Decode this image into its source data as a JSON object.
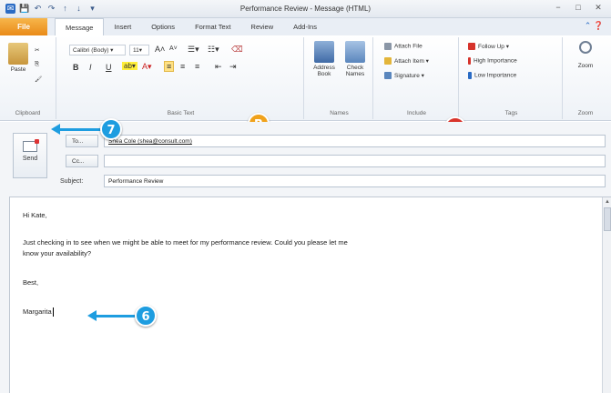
{
  "window": {
    "title": "Performance Review - Message (HTML)"
  },
  "qat_icons": [
    "save-icon",
    "undo-icon",
    "redo-icon",
    "up-arrow-icon",
    "down-arrow-icon"
  ],
  "window_controls": {
    "minimize": "−",
    "restore": "□",
    "close": "✕"
  },
  "tabs": {
    "file": "File",
    "items": [
      "Message",
      "Insert",
      "Options",
      "Format Text",
      "Review",
      "Add-Ins"
    ],
    "active": "Message"
  },
  "ribbon": {
    "clipboard": {
      "label": "Clipboard",
      "paste": "Paste"
    },
    "basic_text": {
      "label": "Basic Text",
      "font": "Calibri (Body)",
      "size": "11",
      "bold": "B",
      "italic": "I",
      "underline": "U"
    },
    "names": {
      "label": "Names",
      "address_book": "Address Book",
      "check_names": "Check Names"
    },
    "include": {
      "label": "Include",
      "attach_file": "Attach File",
      "attach_item": "Attach Item",
      "signature": "Signature"
    },
    "tags": {
      "label": "Tags",
      "follow_up": "Follow Up",
      "high_importance": "High Importance",
      "low_importance": "Low Importance"
    },
    "zoom": {
      "label": "Zoom",
      "zoom": "Zoom"
    }
  },
  "compose": {
    "send_label": "Send",
    "to_label": "To...",
    "cc_label": "Cc...",
    "subject_label": "Subject:",
    "to_value": "Shea Cole (shea@consult.com)",
    "cc_value": "",
    "subject_value": "Performance Review",
    "body": {
      "greeting": "Hi Kate,",
      "line1": "Just checking in to see when we might be able to meet for my performance review. Could you please let me",
      "line2": "know your availability?",
      "closing": "Best,",
      "signature": "Margarita"
    }
  },
  "callouts": {
    "b": {
      "label": "B",
      "color": "#f0a21c"
    },
    "c": {
      "label": "C",
      "color": "#d9342b"
    },
    "seven": {
      "label": "7",
      "color": "#1e9de0"
    },
    "six": {
      "label": "6",
      "color": "#1e9de0"
    }
  }
}
